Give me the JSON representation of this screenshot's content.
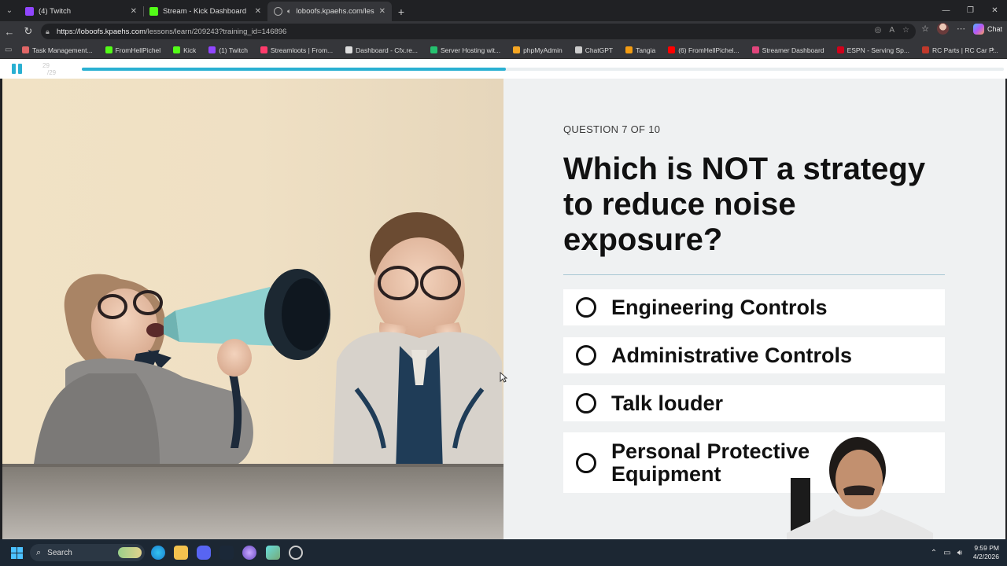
{
  "browser": {
    "tabs": [
      {
        "title": "(4) Twitch",
        "color": "#9146ff"
      },
      {
        "title": "Stream - Kick Dashboard",
        "color": "#53fc18"
      },
      {
        "title": "loboofs.kpaehs.com/lessons/l",
        "color": "#9aa0a6"
      }
    ],
    "url_domain": "https://loboofs.kpaehs.com",
    "url_path": "/lessons/learn/209243?training_id=146896",
    "bookmarks": [
      {
        "label": "Task Management...",
        "color": "#e06666"
      },
      {
        "label": "FromHellPichel",
        "color": "#53fc18"
      },
      {
        "label": "Kick",
        "color": "#53fc18"
      },
      {
        "label": "(1) Twitch",
        "color": "#9146ff"
      },
      {
        "label": "Streamloots | From...",
        "color": "#ff3b6b"
      },
      {
        "label": "Dashboard - Cfx.re...",
        "color": "#dddddd"
      },
      {
        "label": "Server Hosting wit...",
        "color": "#25c16f"
      },
      {
        "label": "phpMyAdmin",
        "color": "#f5a623"
      },
      {
        "label": "ChatGPT",
        "color": "#cccccc"
      },
      {
        "label": "Tangia",
        "color": "#f39c12"
      },
      {
        "label": "(6) FromHellPichel...",
        "color": "#ff0000"
      },
      {
        "label": "Streamer Dashboard",
        "color": "#e0457b"
      },
      {
        "label": "ESPN - Serving Sp...",
        "color": "#d0021b"
      },
      {
        "label": "RC Parts | RC Car P...",
        "color": "#c0392b"
      }
    ],
    "copilot_label": "Chat"
  },
  "lesson": {
    "counter_current": "29",
    "counter_total": "29",
    "progress": 0.46,
    "accent": "#2ab0d2"
  },
  "quiz": {
    "question_number": "QUESTION 7 OF 10",
    "question": "Which is NOT a strategy to reduce noise exposure?",
    "options": [
      "Engineering Controls",
      "Administrative Controls",
      "Talk louder",
      "Personal Protective Equipment"
    ]
  },
  "taskbar": {
    "search_label": "Search",
    "time": "9:59 PM",
    "date": "4/2/2026"
  }
}
